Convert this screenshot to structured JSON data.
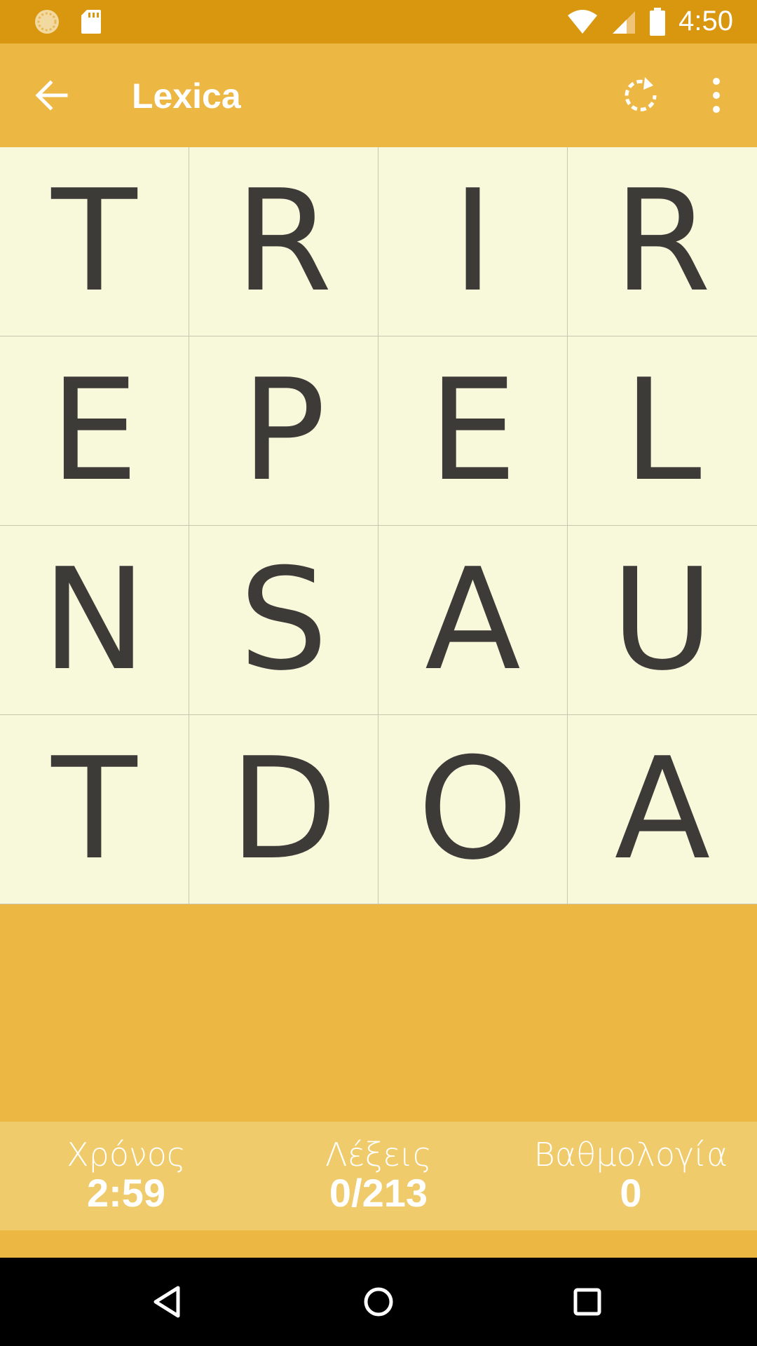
{
  "status_bar": {
    "time": "4:50",
    "icons": [
      "sync-icon",
      "sd-card-icon",
      "wifi-icon",
      "signal-icon",
      "battery-icon"
    ]
  },
  "app_bar": {
    "title": "Lexica",
    "icons": [
      "back-arrow-icon",
      "refresh-icon",
      "more-vert-icon"
    ]
  },
  "board": {
    "rows": [
      [
        "T",
        "R",
        "I",
        "R"
      ],
      [
        "E",
        "P",
        "E",
        "L"
      ],
      [
        "N",
        "S",
        "A",
        "U"
      ],
      [
        "T",
        "D",
        "O",
        "A"
      ]
    ]
  },
  "stats": {
    "time_label": "Χρόνος",
    "time_value": "2:59",
    "words_label": "Λέξεις",
    "words_value": "0/213",
    "score_label": "Βαθμολογία",
    "score_value": "0"
  },
  "colors": {
    "status_bar": "#D8970F",
    "app_bar": "#ECB742",
    "cell_bg": "#F8F8DB",
    "letter": "#3D3B38",
    "score_panel": "#F0CB6B"
  },
  "nav_bar": {
    "icons": [
      "back-triangle-icon",
      "home-circle-icon",
      "recents-square-icon"
    ]
  }
}
